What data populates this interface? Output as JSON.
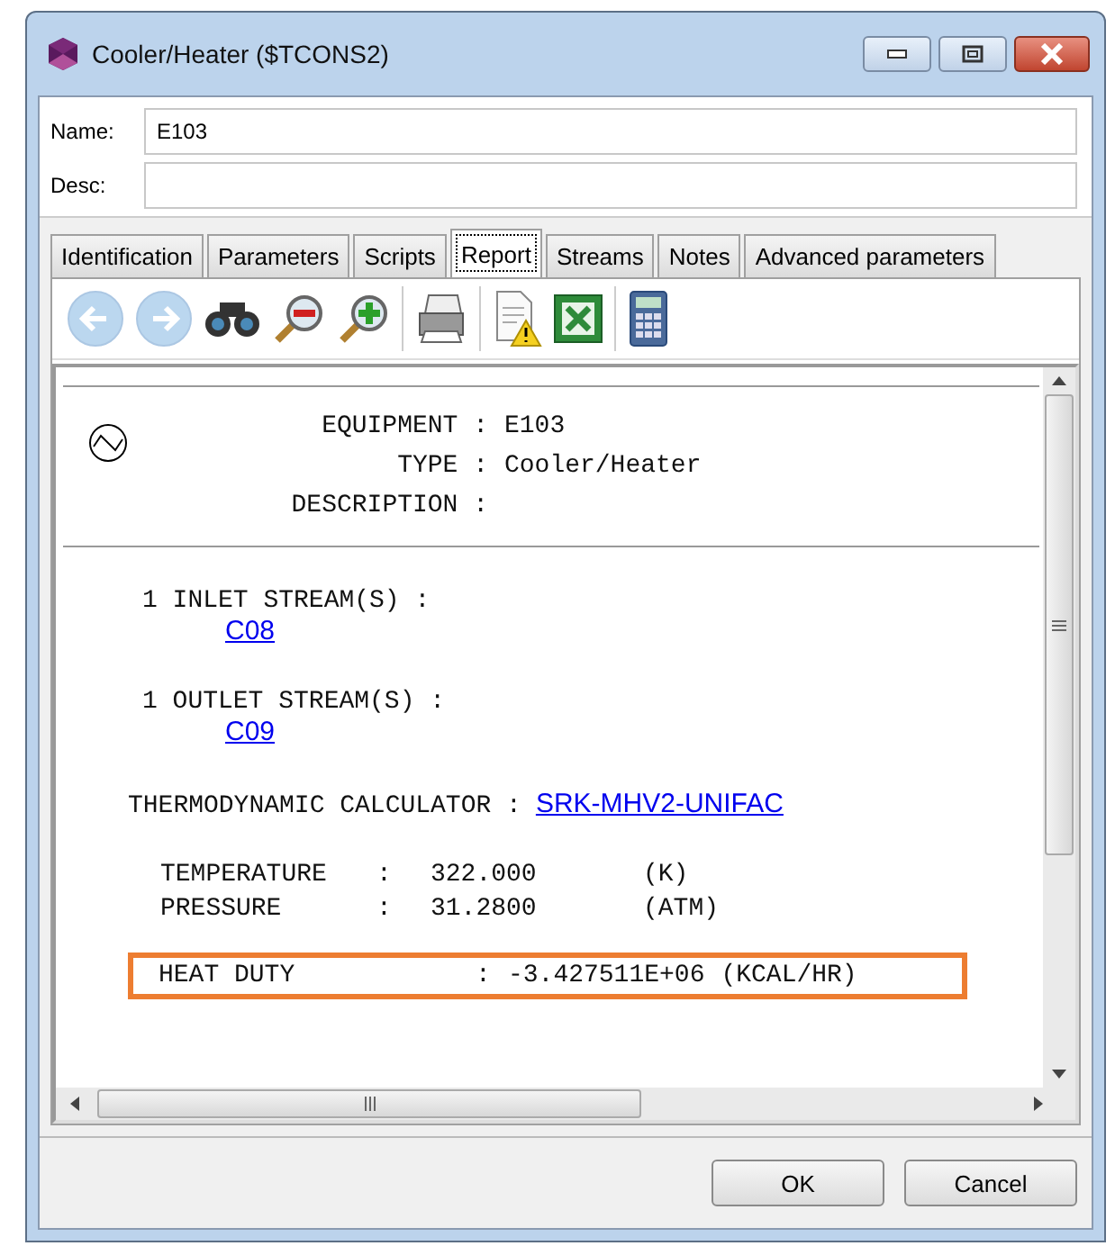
{
  "window": {
    "title": "Cooler/Heater ($TCONS2)"
  },
  "fields": [
    {
      "label": "Name:",
      "value": "E103"
    },
    {
      "label": "Desc:"
    }
  ],
  "tabs": [
    {
      "label": "Identification",
      "selected": false
    },
    {
      "label": "Parameters",
      "selected": false
    },
    {
      "label": "Scripts",
      "selected": false
    },
    {
      "label": "Report",
      "selected": true
    },
    {
      "label": "Streams",
      "selected": false
    },
    {
      "label": "Notes",
      "selected": false
    },
    {
      "label": "Advanced parameters",
      "selected": false
    }
  ],
  "toolbar": [
    {
      "kind": "back"
    },
    {
      "kind": "forward"
    },
    {
      "kind": "binoculars"
    },
    {
      "kind": "zoom-out"
    },
    {
      "kind": "zoom-in"
    },
    {
      "kind": "sep"
    },
    {
      "kind": "printer"
    },
    {
      "kind": "sep"
    },
    {
      "kind": "warning-doc"
    },
    {
      "kind": "spreadsheet"
    },
    {
      "kind": "sep"
    },
    {
      "kind": "calculator"
    }
  ],
  "report": {
    "header": [
      {
        "label": "EQUIPMENT :",
        "value": "E103"
      },
      {
        "label": "TYPE :",
        "value": "Cooler/Heater"
      },
      {
        "label": "DESCRIPTION :"
      }
    ],
    "streams": [
      {
        "label": "1 INLET STREAM(S) :",
        "link": "C08"
      },
      {
        "label": "1 OUTLET STREAM(S) :",
        "link": "C09"
      }
    ],
    "thermo": {
      "label": "THERMODYNAMIC CALCULATOR :",
      "link": "SRK-MHV2-UNIFAC"
    },
    "properties": [
      {
        "name": "TEMPERATURE",
        "sep": ":",
        "value": "322.000",
        "unit": "(K)"
      },
      {
        "name": "PRESSURE",
        "sep": ":",
        "value": "31.2800",
        "unit": "(ATM)"
      }
    ],
    "highlighted": {
      "name": "HEAT DUTY",
      "sep": ":",
      "value": "-3.427511E+06",
      "unit": "(KCAL/HR)"
    }
  },
  "buttons": [
    "OK",
    "Cancel"
  ]
}
